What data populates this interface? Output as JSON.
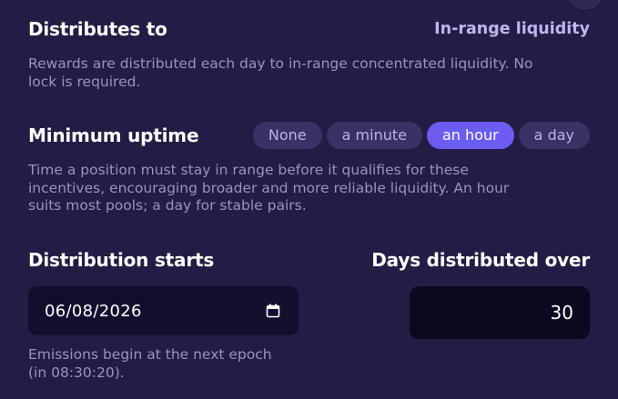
{
  "distributes": {
    "heading": "Distributes to",
    "value": "In-range liquidity",
    "desc_line1": "Rewards are distributed each day to in-range concentrated liquidity. No",
    "desc_line2": "lock is required."
  },
  "uptime": {
    "heading": "Minimum uptime",
    "options": [
      "None",
      "a minute",
      "an hour",
      "a day"
    ],
    "selected": "an hour",
    "desc_line1": "Time a position must stay in range before it qualifies for these",
    "desc_line2": "incentives, encouraging broader and more reliable liquidity. An hour",
    "desc_line3": "suits most pools; a day for stable pairs."
  },
  "start": {
    "heading": "Distribution starts",
    "date_value": "06/08/2026",
    "note_line1": "Emissions begin at the next epoch",
    "note_line2": "(in 08:30:20)."
  },
  "duration": {
    "heading": "Days distributed over",
    "value": "30"
  },
  "colors": {
    "background": "#231d45",
    "accent": "#6b5cf2",
    "chip": "#3a3264",
    "input": "#130e2e"
  }
}
